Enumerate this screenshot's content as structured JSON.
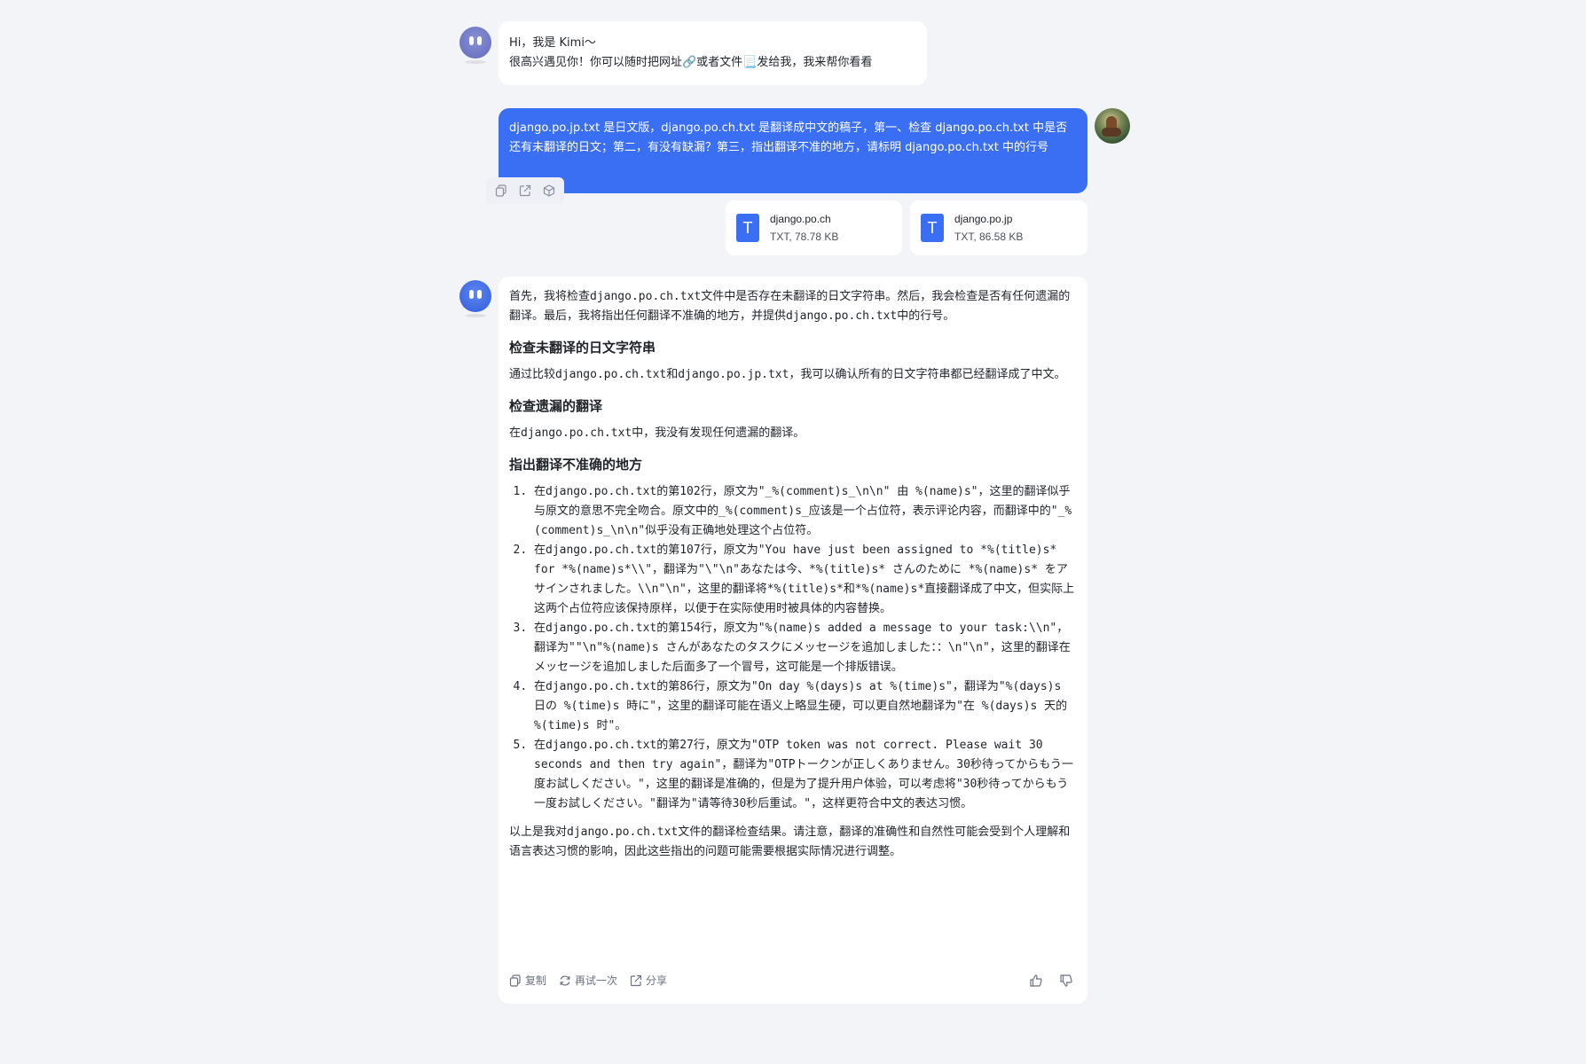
{
  "greeting": {
    "line1": "Hi，我是 Kimi～",
    "line2": "很高兴遇见你！你可以随时把网址🔗或者文件📃发给我，我来帮你看看"
  },
  "user_message": {
    "text": "django.po.jp.txt 是日文版，django.po.ch.txt 是翻译成中文的稿子，第一、检查 django.po.ch.txt 中是否还有未翻译的日文；第二，有没有缺漏？第三，指出翻译不准的地方，请标明 django.po.ch.txt 中的行号"
  },
  "attachments": [
    {
      "name": "django.po.ch",
      "meta": "TXT, 78.78 KB",
      "icon": "T"
    },
    {
      "name": "django.po.jp",
      "meta": "TXT, 86.58 KB",
      "icon": "T"
    }
  ],
  "answer": {
    "intro": "首先，我将检查django.po.ch.txt文件中是否存在未翻译的日文字符串。然后，我会检查是否有任何遗漏的翻译。最后，我将指出任何翻译不准确的地方，并提供django.po.ch.txt中的行号。",
    "h1": "检查未翻译的日文字符串",
    "p1": "通过比较django.po.ch.txt和django.po.jp.txt，我可以确认所有的日文字符串都已经翻译成了中文。",
    "h2": "检查遗漏的翻译",
    "p2": "在django.po.ch.txt中，我没有发现任何遗漏的翻译。",
    "h3": "指出翻译不准确的地方",
    "items": [
      "在django.po.ch.txt的第102行，原文为\"_%(comment)s_\\n\\n\" 由 %(name)s\"，这里的翻译似乎与原文的意思不完全吻合。原文中的_%(comment)s_应该是一个占位符，表示评论内容，而翻译中的\"_%(comment)s_\\n\\n\"似乎没有正确地处理这个占位符。",
      "在django.po.ch.txt的第107行，原文为\"You have just been assigned to *%(title)s* for *%(name)s*\\\\\"，翻译为\"\\\"\\n\"あなたは今、*%(title)s* さんのために *%(name)s* をアサインされました。\\\\n\"\\n\"，这里的翻译将*%(title)s*和*%(name)s*直接翻译成了中文，但实际上这两个占位符应该保持原样，以便于在实际使用时被具体的内容替换。",
      "在django.po.ch.txt的第154行，原文为\"%(name)s added a message to your task:\\\\n\"，翻译为\"\"\\n\"%(name)s さんがあなたのタスクにメッセージを追加しました：：\\n\"\\n\"，这里的翻译在メッセージを追加しました后面多了一个冒号，这可能是一个排版错误。",
      "在django.po.ch.txt的第86行，原文为\"On day %(days)s at %(time)s\"，翻译为\"%(days)s 日の %(time)s 時に\"，这里的翻译可能在语义上略显生硬，可以更自然地翻译为\"在 %(days)s 天的 %(time)s 时\"。",
      "在django.po.ch.txt的第27行，原文为\"OTP token was not correct. Please wait 30 seconds and then try again\"，翻译为\"OTPトークンが正しくありません。30秒待ってからもう一度お試しください。\"，这里的翻译是准确的，但是为了提升用户体验，可以考虑将\"30秒待ってからもう一度お試しください。\"翻译为\"请等待30秒后重试。\"，这样更符合中文的表达习惯。"
    ],
    "outro": "以上是我对django.po.ch.txt文件的翻译检查结果。请注意，翻译的准确性和自然性可能会受到个人理解和语言表达习惯的影响，因此这些指出的问题可能需要根据实际情况进行调整。",
    "actions": {
      "copy": "复制",
      "retry": "再试一次",
      "share": "分享"
    }
  }
}
